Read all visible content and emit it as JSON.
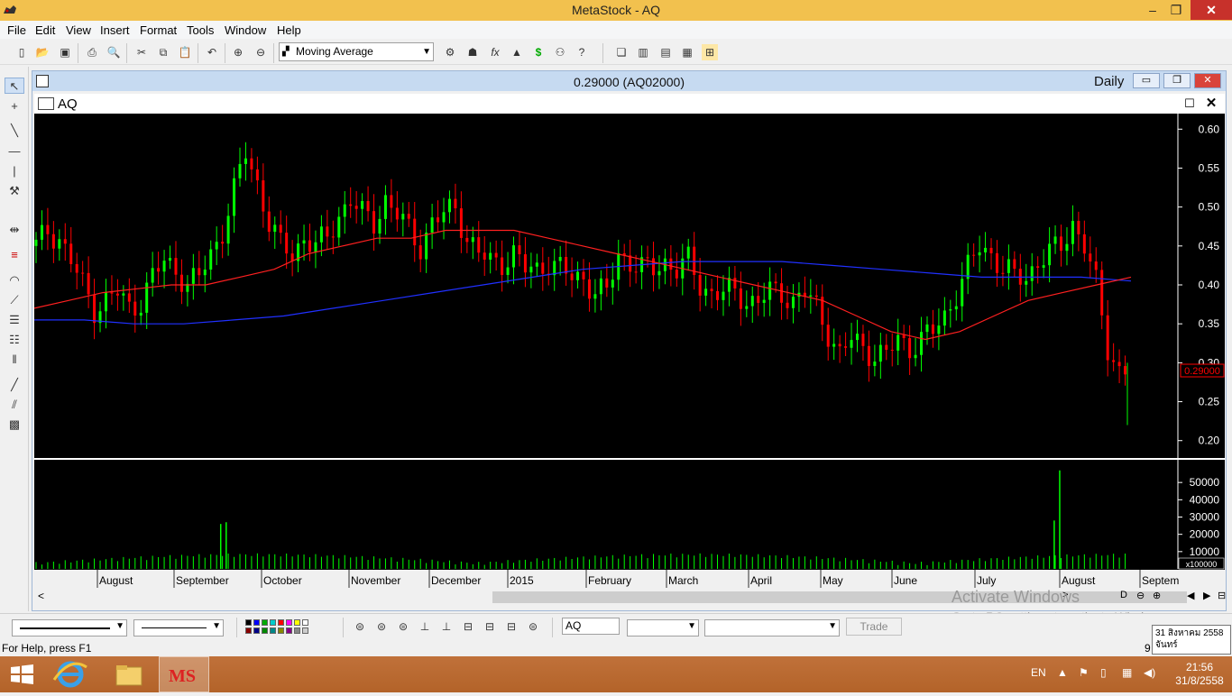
{
  "window": {
    "title": "MetaStock - AQ"
  },
  "menu": [
    "File",
    "Edit",
    "View",
    "Insert",
    "Format",
    "Tools",
    "Window",
    "Help"
  ],
  "toolbar": {
    "indicator_select": "Moving Average"
  },
  "chart_window": {
    "title": "0.29000 (AQ02000)",
    "periodicity": "Daily"
  },
  "security": {
    "name": "AQ"
  },
  "price_label": "0.29000",
  "volume_multiplier": "x100000",
  "bottom": {
    "symbol": "AQ",
    "trade_label": "Trade"
  },
  "status": {
    "help": "For Help, press F1",
    "partial": "9"
  },
  "tooltip": {
    "date": "31 สิงหาคม 2558",
    "day": "จันทร์"
  },
  "activate": {
    "line1": "Activate Windows",
    "line2": "Go to PC settings to activate Windows."
  },
  "tray": {
    "lang": "EN",
    "time": "21:56",
    "date": "31/8/2558"
  },
  "colors": {
    "up": "#00ff00",
    "down": "#ff0000",
    "ma_short": "#ff2020",
    "ma_long": "#2030ff"
  },
  "chart_data": {
    "type": "candlestick",
    "price_axis": {
      "ticks": [
        0.6,
        0.55,
        0.5,
        0.45,
        0.4,
        0.35,
        0.3,
        0.25,
        0.2
      ],
      "ylim": [
        0.18,
        0.62
      ]
    },
    "volume_axis": {
      "ticks": [
        50000,
        40000,
        30000,
        20000,
        10000
      ]
    },
    "x_labels": [
      "August",
      "September",
      "October",
      "November",
      "December",
      "2015",
      "February",
      "March",
      "April",
      "May",
      "June",
      "July",
      "August",
      "Septem"
    ],
    "price_series": [
      0.45,
      0.47,
      0.46,
      0.43,
      0.4,
      0.37,
      0.38,
      0.39,
      0.37,
      0.38,
      0.41,
      0.43,
      0.42,
      0.4,
      0.41,
      0.44,
      0.47,
      0.52,
      0.57,
      0.53,
      0.48,
      0.45,
      0.44,
      0.46,
      0.45,
      0.46,
      0.49,
      0.51,
      0.49,
      0.48,
      0.51,
      0.49,
      0.47,
      0.45,
      0.48,
      0.49,
      0.5,
      0.46,
      0.44,
      0.43,
      0.43,
      0.44,
      0.42,
      0.42,
      0.43,
      0.42,
      0.41,
      0.41,
      0.39,
      0.39,
      0.44,
      0.43,
      0.42,
      0.42,
      0.43,
      0.42,
      0.43,
      0.4,
      0.39,
      0.39,
      0.39,
      0.38,
      0.38,
      0.39,
      0.39,
      0.38,
      0.39,
      0.37,
      0.34,
      0.31,
      0.33,
      0.32,
      0.31,
      0.31,
      0.33,
      0.32,
      0.33,
      0.34,
      0.36,
      0.39,
      0.42,
      0.45,
      0.44,
      0.42,
      0.41,
      0.41,
      0.43,
      0.44,
      0.45,
      0.48,
      0.45,
      0.4,
      0.32,
      0.29
    ],
    "ma_short": [
      0.37,
      0.38,
      0.39,
      0.395,
      0.4,
      0.4,
      0.41,
      0.42,
      0.44,
      0.45,
      0.46,
      0.46,
      0.47,
      0.47,
      0.47,
      0.46,
      0.45,
      0.44,
      0.43,
      0.42,
      0.41,
      0.4,
      0.39,
      0.38,
      0.36,
      0.34,
      0.33,
      0.34,
      0.36,
      0.38,
      0.39,
      0.4,
      0.41
    ],
    "ma_long": [
      0.355,
      0.355,
      0.35,
      0.35,
      0.355,
      0.36,
      0.37,
      0.38,
      0.39,
      0.4,
      0.41,
      0.42,
      0.425,
      0.43,
      0.43,
      0.43,
      0.425,
      0.42,
      0.415,
      0.41,
      0.41,
      0.41,
      0.405
    ],
    "volume_spikes": [
      {
        "x_frac": 0.17,
        "v": 26000
      },
      {
        "x_frac": 0.175,
        "v": 27000
      },
      {
        "x_frac": 0.93,
        "v": 28000
      },
      {
        "x_frac": 0.935,
        "v": 57000
      }
    ]
  }
}
